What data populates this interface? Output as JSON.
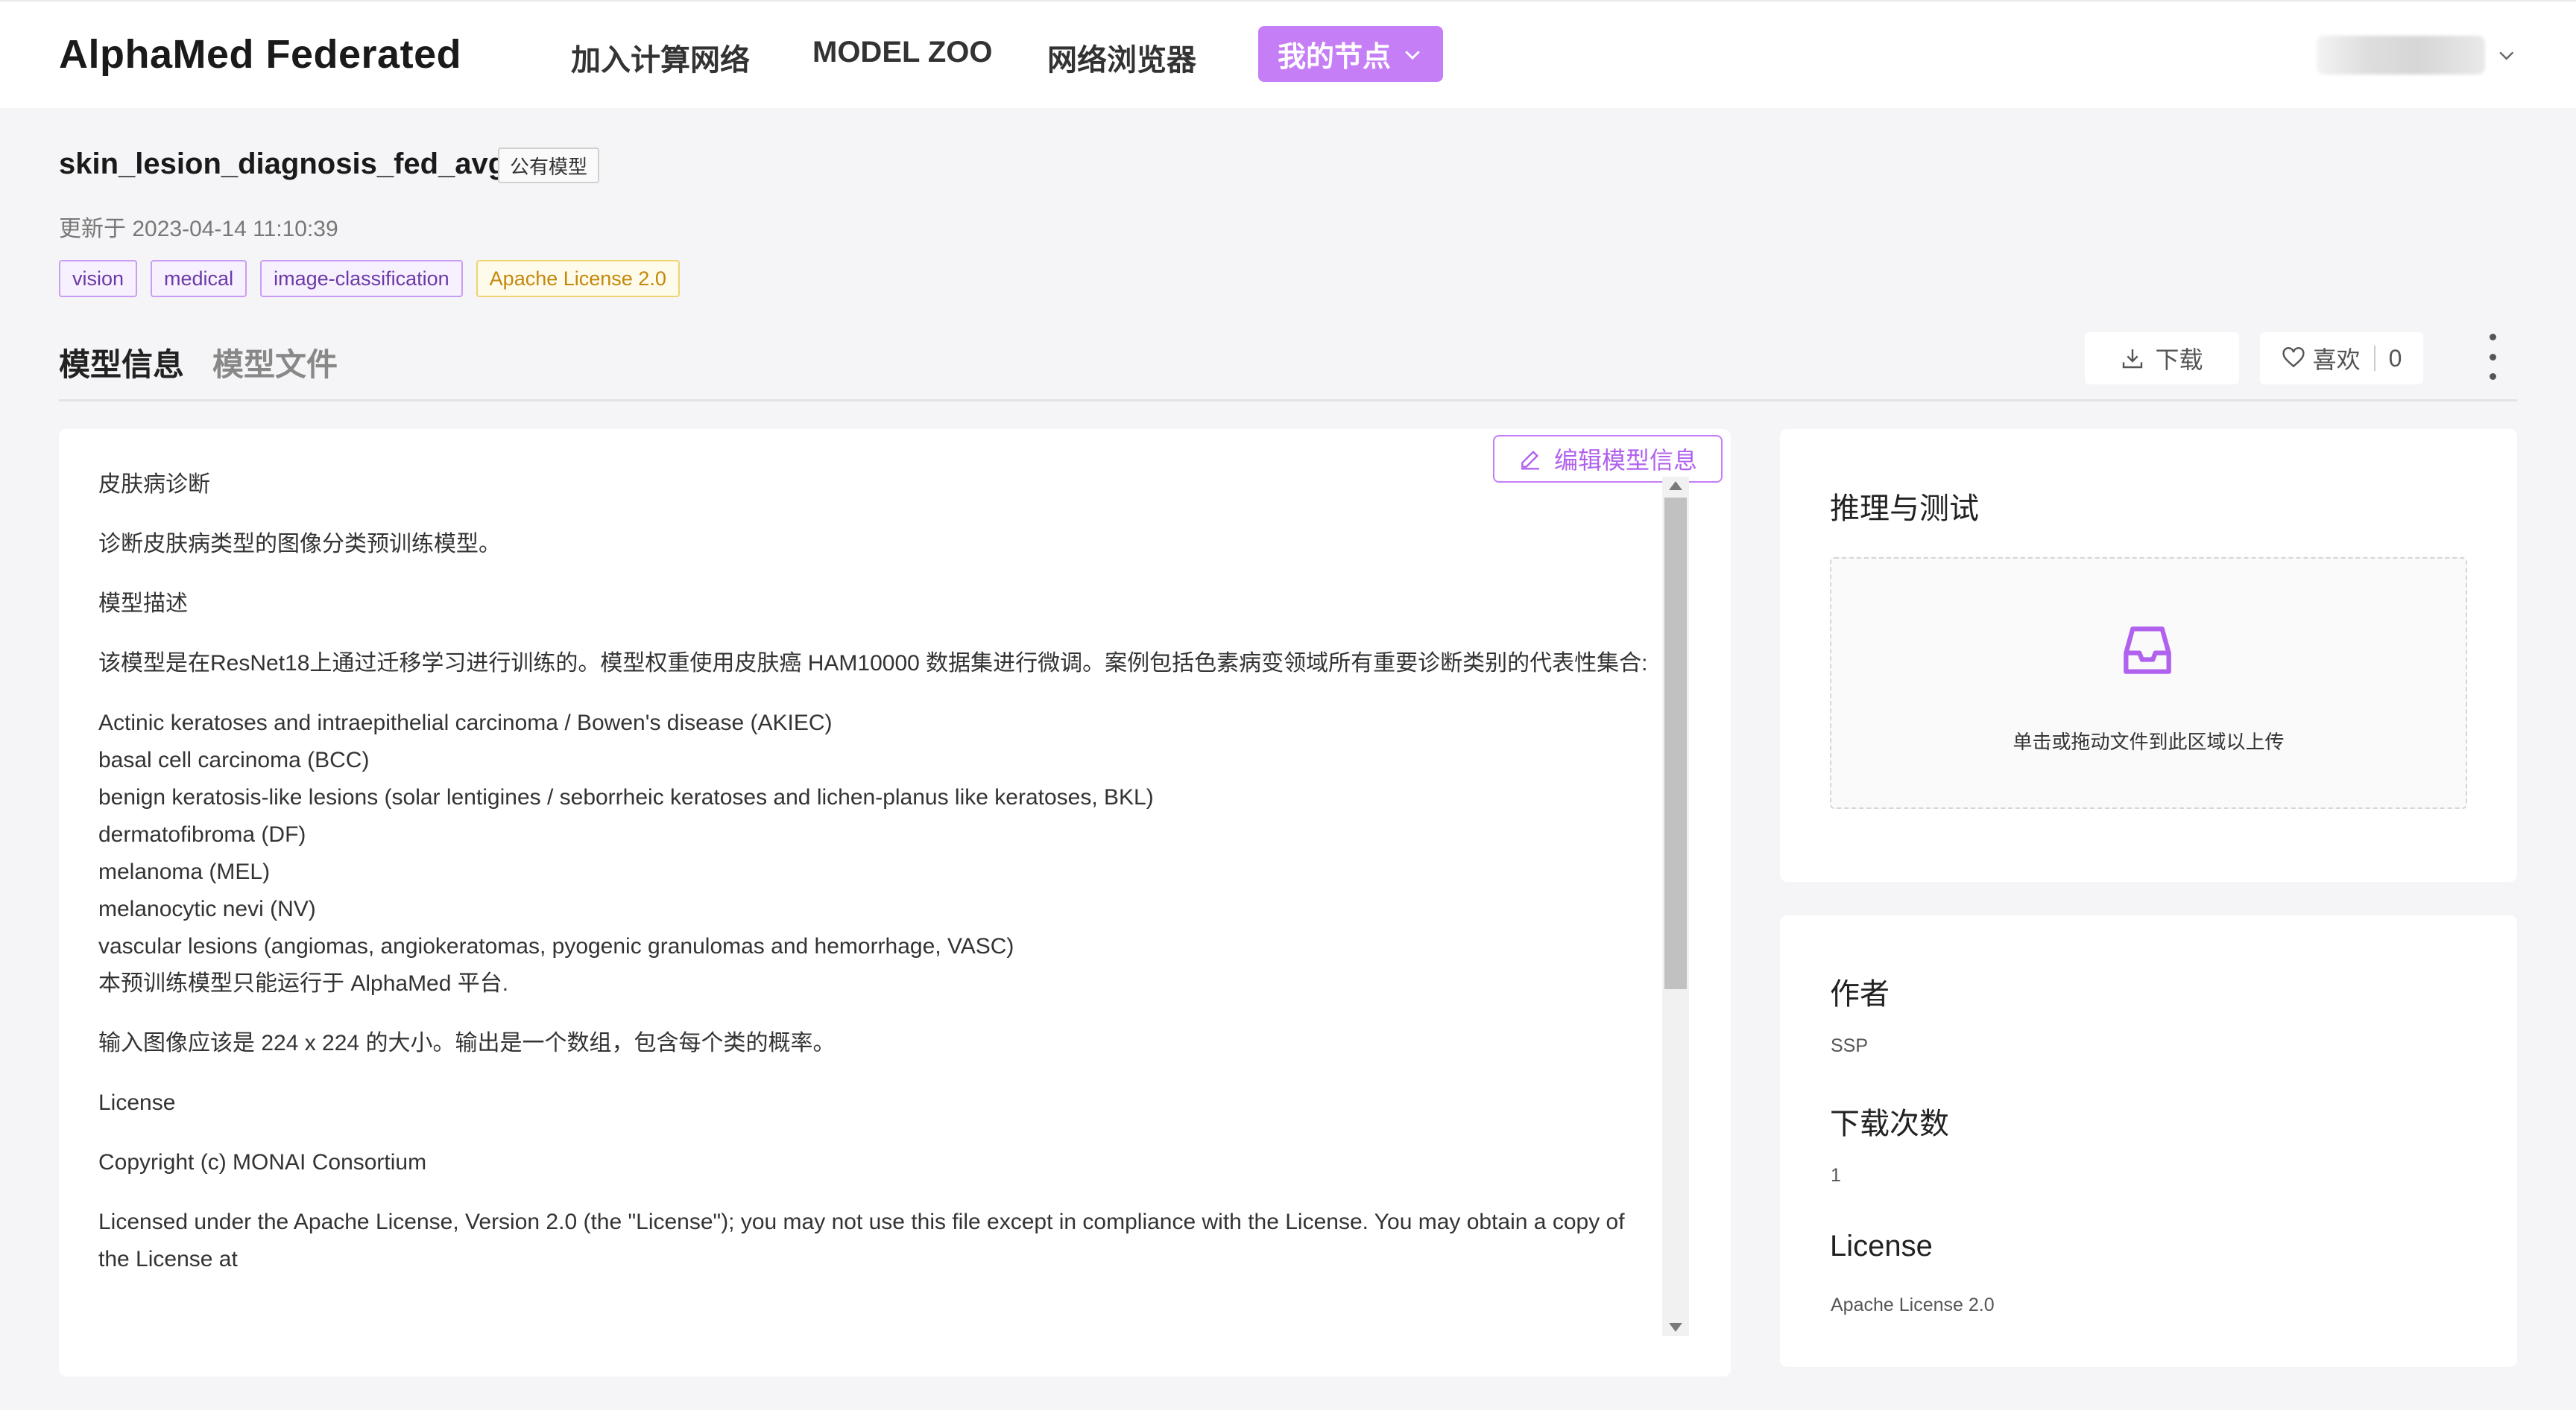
{
  "header": {
    "brand": "AlphaMed Federated",
    "nav": {
      "join": "加入计算网络",
      "zoo": "MODEL ZOO",
      "browser": "网络浏览器",
      "my_node": "我的节点"
    }
  },
  "model": {
    "name": "skin_lesion_diagnosis_fed_avg",
    "visibility_badge": "公有模型",
    "updated": "更新于 2023-04-14 11:10:39",
    "tags": [
      "vision",
      "medical",
      "image-classification",
      "Apache License 2.0"
    ]
  },
  "tabs": {
    "info": "模型信息",
    "files": "模型文件"
  },
  "actions": {
    "download": "下载",
    "like": "喜欢",
    "like_count": "0",
    "edit": "编辑模型信息"
  },
  "content": {
    "title": "皮肤病诊断",
    "summary": "诊断皮肤病类型的图像分类预训练模型。",
    "desc_heading": "模型描述",
    "desc": "该模型是在ResNet18上通过迁移学习进行训练的。模型权重使用皮肤癌 HAM10000 数据集进行微调。案例包括色素病变领域所有重要诊断类别的代表性集合:",
    "classes": [
      "Actinic keratoses and intraepithelial carcinoma / Bowen's disease (AKIEC)",
      "basal cell carcinoma (BCC)",
      "benign keratosis-like lesions (solar lentigines / seborrheic keratoses and lichen-planus like keratoses, BKL)",
      "dermatofibroma (DF)",
      "melanoma (MEL)",
      "melanocytic nevi (NV)",
      "vascular lesions (angiomas, angiokeratomas, pyogenic granulomas and hemorrhage, VASC)",
      "本预训练模型只能运行于 AlphaMed 平台."
    ],
    "io_note": "输入图像应该是 224 x 224 的大小。输出是一个数组，包含每个类的概率。",
    "license_heading": "License",
    "copyright": "Copyright (c) MONAI Consortium",
    "license_text": "Licensed under the Apache License, Version 2.0 (the \"License\"); you may not use this file except in compliance with the License. You may obtain a copy of the License at"
  },
  "inference": {
    "title": "推理与测试",
    "upload_hint": "单击或拖动文件到此区域以上传"
  },
  "meta": {
    "author_label": "作者",
    "author": "SSP",
    "downloads_label": "下载次数",
    "downloads": "1",
    "license_label": "License",
    "license": "Apache License 2.0"
  },
  "colors": {
    "accent": "#c57ef5",
    "background": "#f5f5f7",
    "tag_purple_border": "#c89ef2",
    "tag_orange_border": "#f0d373"
  }
}
